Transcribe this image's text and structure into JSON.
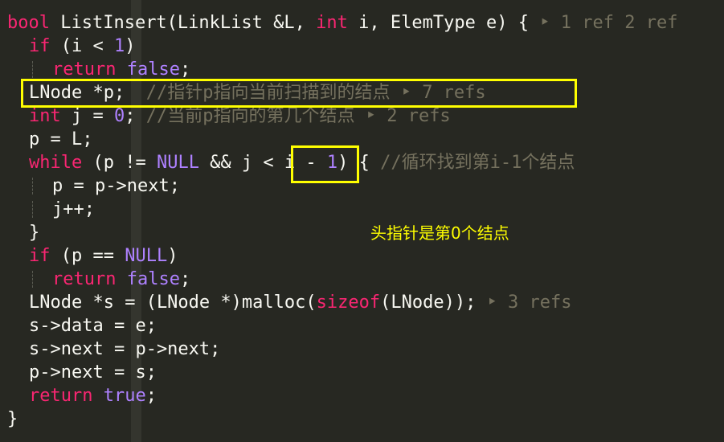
{
  "code": {
    "l1": {
      "t_bool": "bool",
      "t_sig": " ListInsert(LinkList &L, ",
      "t_int": "int",
      "t_i": " i, ElemType e) { ",
      "lens": "‣ 1 ref 2 ref"
    },
    "l2": {
      "kw_if": "if",
      "a": " (i < ",
      "n1": "1",
      "b": ")"
    },
    "l3": {
      "kw_return": "return",
      "sp": " ",
      "c_false": "false",
      "semi": ";"
    },
    "l4": {
      "code": "LNode *p;",
      "comment": "  //指针p指向当前扫描到的结点 ",
      "lens": "‣ 7 refs"
    },
    "l5": {
      "t_int": "int",
      "a": " j = ",
      "n0": "0",
      "b": "; ",
      "comment": "//当前p指向的第几个结点 ",
      "lens": "‣ 2 refs"
    },
    "l6": {
      "code": "p = L;"
    },
    "l7": {
      "kw_while": "while",
      "a": " (p != ",
      "c_null": "NULL",
      "b": " && j < ",
      "c_i": "i - ",
      "n1": "1",
      "d": ") { ",
      "comment": "//循环找到第i-1个结点"
    },
    "l8": {
      "code": "p = p->next;"
    },
    "l9": {
      "code": "j++;"
    },
    "l10": {
      "code": "}"
    },
    "l11": {
      "kw_if": "if",
      "a": " (p == ",
      "c_null": "NULL",
      "b": ")"
    },
    "l12": {
      "kw_return": "return",
      "sp": " ",
      "c_false": "false",
      "semi": ";"
    },
    "l13": {
      "a": "LNode *s = (LNode *)malloc(",
      "kw_sizeof": "sizeof",
      "b": "(LNode)); ",
      "lens": "‣ 3 refs"
    },
    "l14": {
      "code": "s->data = e;"
    },
    "l15": {
      "code": "s->next = p->next;"
    },
    "l16": {
      "code": "p->next = s;"
    },
    "l17": {
      "kw_return": "return",
      "sp": " ",
      "c_true": "true",
      "semi": ";"
    },
    "l18": {
      "code": "}"
    }
  },
  "annotation": {
    "note": "头指针是第0个结点",
    "highlight_color": "#ffff00"
  }
}
